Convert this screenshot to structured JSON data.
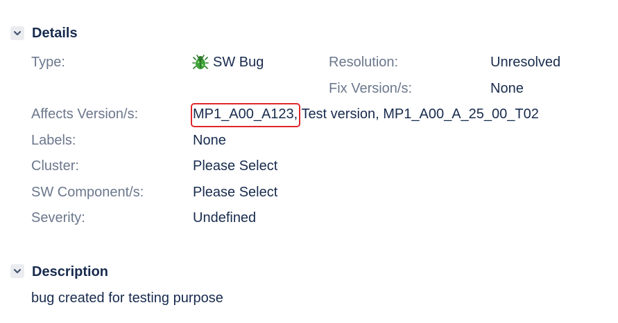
{
  "details": {
    "title": "Details",
    "toggle_icon": "chevron-down-icon",
    "fields": {
      "type": {
        "label": "Type:",
        "value": "SW Bug",
        "icon": "bug-icon"
      },
      "resolution": {
        "label": "Resolution:",
        "value": "Unresolved"
      },
      "fix_version": {
        "label": "Fix Version/s:",
        "value": "None"
      },
      "affects_version": {
        "label": "Affects Version/s:",
        "values": [
          "MP1_A00_A123,",
          "Test version,",
          "MP1_A00_A_25_00_T02"
        ]
      },
      "labels": {
        "label": "Labels:",
        "value": "None"
      },
      "cluster": {
        "label": "Cluster:",
        "value": "Please Select"
      },
      "sw_component": {
        "label": "SW Component/s:",
        "value": "Please Select"
      },
      "severity": {
        "label": "Severity:",
        "value": "Undefined"
      }
    }
  },
  "description": {
    "title": "Description",
    "toggle_icon": "chevron-down-icon",
    "text": "bug created for testing purpose"
  },
  "colors": {
    "label": "#6b778c",
    "text": "#172b4d",
    "highlight_border": "#e0262b",
    "toggle_bg": "#ebecf0",
    "bug_green": "#3fa33a"
  }
}
